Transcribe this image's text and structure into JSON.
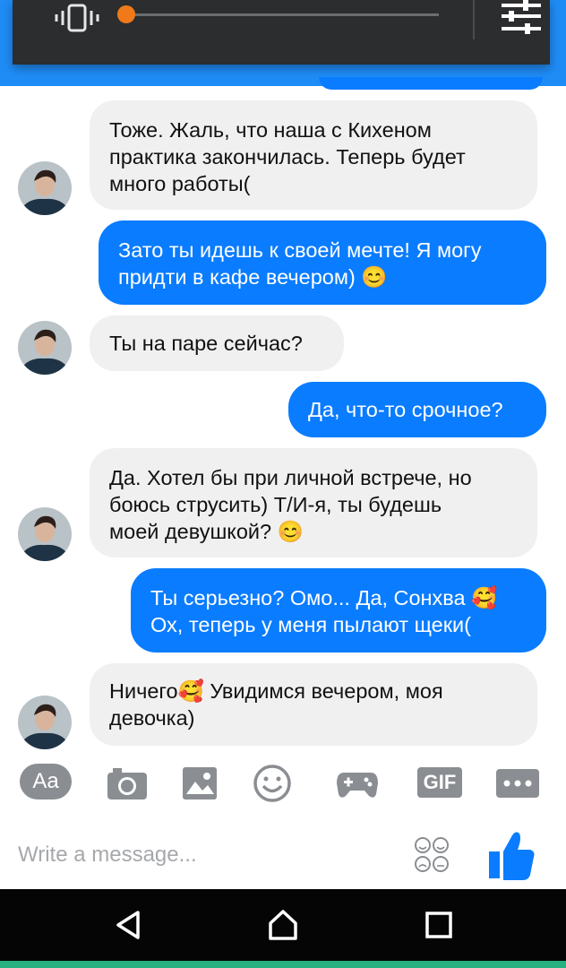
{
  "messages": [
    {
      "side": "in",
      "text": "Тоже. Жаль, что наша с Кихеном\nпрактика закончилась. Теперь будет\nмного работы("
    },
    {
      "side": "out",
      "text": "Зато ты идешь к своей мечте! Я могу\nпридти в кафе вечером) 😊"
    },
    {
      "side": "in",
      "text": "Ты на паре сейчас?"
    },
    {
      "side": "out",
      "text": "Да, что-то срочное?"
    },
    {
      "side": "in",
      "text": "Да. Хотел бы при личной встрече, но\nбоюсь струсить) Т/И-я, ты будешь\nмоей девушкой? 😊"
    },
    {
      "side": "out",
      "text": "Ты серьезно? Омо... Да, Сонхва 🥰\nОх, теперь у меня пылают щеки("
    },
    {
      "side": "in",
      "text": "Ничего🥰 Увидимся вечером, моя\nдевочка)"
    }
  ],
  "toolbar": {
    "text_button_label": "Aa",
    "gif_button_label": "GIF",
    "icons": [
      "text-format-icon",
      "camera-icon",
      "image-icon",
      "emoji-icon",
      "gamepad-icon",
      "gif-icon",
      "more-icon"
    ]
  },
  "composer": {
    "placeholder": "Write a message...",
    "value": ""
  },
  "colors": {
    "brand_blue": "#0a7cff",
    "incoming_bubble": "#f0f0f1",
    "toolbar_icon": "#8a8d91",
    "volume_accent": "#f07a1a"
  },
  "volume_overlay": {
    "level": 0.02
  }
}
